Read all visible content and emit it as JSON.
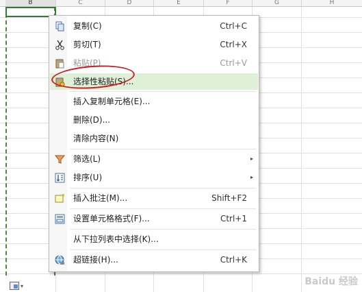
{
  "columns": [
    "B",
    "C",
    "D",
    "E",
    "F",
    "G",
    "H"
  ],
  "paste_options_arrow": "▾",
  "menu": {
    "items": [
      {
        "label": "复制(C)",
        "shortcut": "Ctrl+C",
        "icon": "copy-icon"
      },
      {
        "label": "剪切(T)",
        "shortcut": "Ctrl+X",
        "icon": "scissors-icon"
      },
      {
        "label": "粘贴(P)",
        "shortcut": "Ctrl+V",
        "icon": "paste-icon",
        "disabled": true
      },
      {
        "label": "选择性粘贴(S)...",
        "shortcut": "",
        "icon": "paste-special-icon",
        "highlighted": true
      },
      {
        "label": "插入复制单元格(E)...",
        "shortcut": ""
      },
      {
        "label": "删除(D)...",
        "shortcut": ""
      },
      {
        "label": "清除内容(N)",
        "shortcut": ""
      },
      {
        "label": "筛选(L)",
        "submenu": true,
        "icon": "filter-icon"
      },
      {
        "label": "排序(U)",
        "submenu": true,
        "icon": "sort-icon"
      },
      {
        "label": "插入批注(M)...",
        "shortcut": "Shift+F2",
        "icon": "comment-icon"
      },
      {
        "label": "设置单元格格式(F)...",
        "shortcut": "Ctrl+1",
        "icon": "format-cells-icon"
      },
      {
        "label": "从下拉列表中选择(K)...",
        "shortcut": ""
      },
      {
        "label": "超链接(H)...",
        "shortcut": "Ctrl+K",
        "icon": "hyperlink-icon"
      }
    ],
    "submenu_arrow": "▸"
  },
  "watermark": "Baidu 经验",
  "colors": {
    "highlight": "#dff0d8",
    "annotation_circle": "#cc1f1f",
    "selection_border": "#2e7d32"
  }
}
